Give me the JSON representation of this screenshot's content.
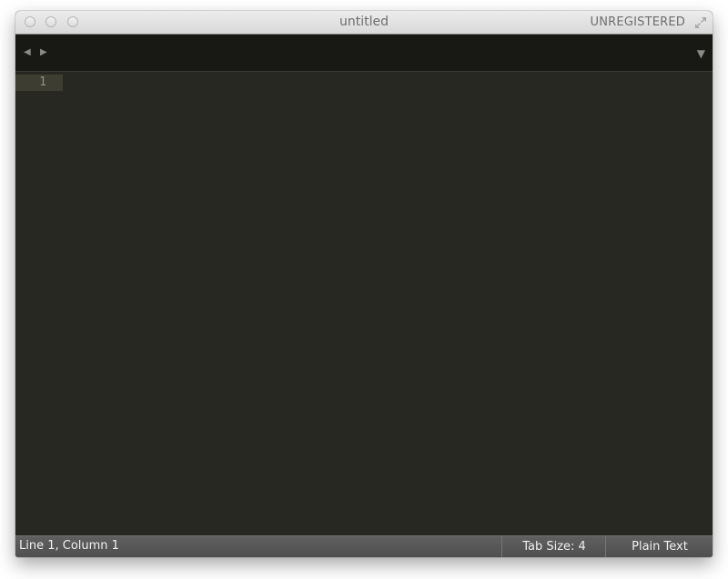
{
  "window": {
    "title": "untitled",
    "registration_status": "UNREGISTERED"
  },
  "tabbar": {
    "back_glyph": "◀",
    "forward_glyph": "▶",
    "dropdown_glyph": "▼"
  },
  "editor": {
    "line_numbers": [
      "1"
    ],
    "content": ""
  },
  "statusbar": {
    "position": "Line 1, Column 1",
    "tab_size": "Tab Size: 4",
    "syntax": "Plain Text"
  }
}
